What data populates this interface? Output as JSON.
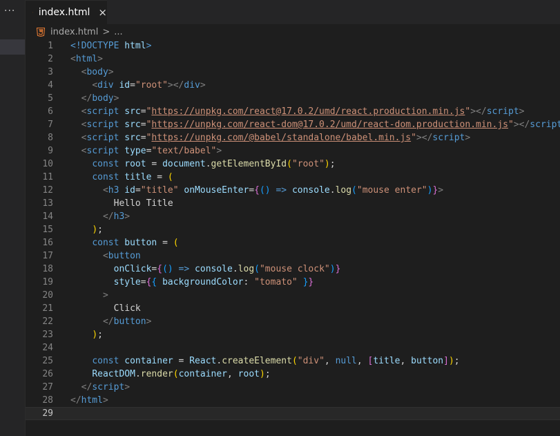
{
  "tab": {
    "file_name": "index.html",
    "close_glyph": "×"
  },
  "breadcrumb": {
    "file_name": "index.html",
    "separator": ">",
    "more": "..."
  },
  "sidebar": {
    "more_glyph": "···"
  },
  "current_line": 29,
  "lines": [
    [
      {
        "c": "tg",
        "t": "<!DOCTYPE "
      },
      {
        "c": "at",
        "t": "html"
      },
      {
        "c": "tg",
        "t": ">"
      }
    ],
    [
      {
        "c": "gy",
        "t": "<"
      },
      {
        "c": "tg",
        "t": "html"
      },
      {
        "c": "gy",
        "t": ">"
      }
    ],
    [
      {
        "c": "tx",
        "t": "  "
      },
      {
        "c": "gy",
        "t": "<"
      },
      {
        "c": "tg",
        "t": "body"
      },
      {
        "c": "gy",
        "t": ">"
      }
    ],
    [
      {
        "c": "tx",
        "t": "    "
      },
      {
        "c": "gy",
        "t": "<"
      },
      {
        "c": "tg",
        "t": "div "
      },
      {
        "c": "at",
        "t": "id"
      },
      {
        "c": "tx",
        "t": "="
      },
      {
        "c": "st",
        "t": "\"root\""
      },
      {
        "c": "gy",
        "t": "></"
      },
      {
        "c": "tg",
        "t": "div"
      },
      {
        "c": "gy",
        "t": ">"
      }
    ],
    [
      {
        "c": "tx",
        "t": "  "
      },
      {
        "c": "gy",
        "t": "</"
      },
      {
        "c": "tg",
        "t": "body"
      },
      {
        "c": "gy",
        "t": ">"
      }
    ],
    [
      {
        "c": "tx",
        "t": "  "
      },
      {
        "c": "gy",
        "t": "<"
      },
      {
        "c": "tg",
        "t": "script "
      },
      {
        "c": "at",
        "t": "src"
      },
      {
        "c": "tx",
        "t": "="
      },
      {
        "c": "st",
        "t": "\""
      },
      {
        "c": "ul",
        "t": "https://unpkg.com/react@17.0.2/umd/react.production.min.js"
      },
      {
        "c": "st",
        "t": "\""
      },
      {
        "c": "gy",
        "t": "></"
      },
      {
        "c": "tg",
        "t": "script"
      },
      {
        "c": "gy",
        "t": ">"
      }
    ],
    [
      {
        "c": "tx",
        "t": "  "
      },
      {
        "c": "gy",
        "t": "<"
      },
      {
        "c": "tg",
        "t": "script "
      },
      {
        "c": "at",
        "t": "src"
      },
      {
        "c": "tx",
        "t": "="
      },
      {
        "c": "st",
        "t": "\""
      },
      {
        "c": "ul",
        "t": "https://unpkg.com/react-dom@17.0.2/umd/react-dom.production.min.js"
      },
      {
        "c": "st",
        "t": "\""
      },
      {
        "c": "gy",
        "t": "></"
      },
      {
        "c": "tg",
        "t": "script"
      },
      {
        "c": "gy",
        "t": ">"
      }
    ],
    [
      {
        "c": "tx",
        "t": "  "
      },
      {
        "c": "gy",
        "t": "<"
      },
      {
        "c": "tg",
        "t": "script "
      },
      {
        "c": "at",
        "t": "src"
      },
      {
        "c": "tx",
        "t": "="
      },
      {
        "c": "st",
        "t": "\""
      },
      {
        "c": "ul",
        "t": "https://unpkg.com/@babel/standalone/babel.min.js"
      },
      {
        "c": "st",
        "t": "\""
      },
      {
        "c": "gy",
        "t": "></"
      },
      {
        "c": "tg",
        "t": "script"
      },
      {
        "c": "gy",
        "t": ">"
      }
    ],
    [
      {
        "c": "tx",
        "t": "  "
      },
      {
        "c": "gy",
        "t": "<"
      },
      {
        "c": "tg",
        "t": "script "
      },
      {
        "c": "at",
        "t": "type"
      },
      {
        "c": "tx",
        "t": "="
      },
      {
        "c": "st",
        "t": "\"text/babel\""
      },
      {
        "c": "gy",
        "t": ">"
      }
    ],
    [
      {
        "c": "tx",
        "t": "    "
      },
      {
        "c": "kw",
        "t": "const "
      },
      {
        "c": "vr",
        "t": "root"
      },
      {
        "c": "tx",
        "t": " = "
      },
      {
        "c": "vr",
        "t": "document"
      },
      {
        "c": "tx",
        "t": "."
      },
      {
        "c": "fn",
        "t": "getElementById"
      },
      {
        "c": "yb",
        "t": "("
      },
      {
        "c": "st",
        "t": "\"root\""
      },
      {
        "c": "yb",
        "t": ")"
      },
      {
        "c": "tx",
        "t": ";"
      }
    ],
    [
      {
        "c": "tx",
        "t": "    "
      },
      {
        "c": "kw",
        "t": "const "
      },
      {
        "c": "vr",
        "t": "title"
      },
      {
        "c": "tx",
        "t": " = "
      },
      {
        "c": "yb",
        "t": "("
      }
    ],
    [
      {
        "c": "tx",
        "t": "      "
      },
      {
        "c": "gy",
        "t": "<"
      },
      {
        "c": "tg",
        "t": "h3 "
      },
      {
        "c": "at",
        "t": "id"
      },
      {
        "c": "tx",
        "t": "="
      },
      {
        "c": "st",
        "t": "\"title\" "
      },
      {
        "c": "at",
        "t": "onMouseEnter"
      },
      {
        "c": "tx",
        "t": "="
      },
      {
        "c": "pb",
        "t": "{"
      },
      {
        "c": "bb",
        "t": "()"
      },
      {
        "c": "kw",
        "t": " => "
      },
      {
        "c": "vr",
        "t": "console"
      },
      {
        "c": "tx",
        "t": "."
      },
      {
        "c": "fn",
        "t": "log"
      },
      {
        "c": "bb",
        "t": "("
      },
      {
        "c": "st",
        "t": "\"mouse enter\""
      },
      {
        "c": "bb",
        "t": ")"
      },
      {
        "c": "pb",
        "t": "}"
      },
      {
        "c": "gy",
        "t": ">"
      }
    ],
    [
      {
        "c": "tx",
        "t": "        Hello Title"
      }
    ],
    [
      {
        "c": "tx",
        "t": "      "
      },
      {
        "c": "gy",
        "t": "</"
      },
      {
        "c": "tg",
        "t": "h3"
      },
      {
        "c": "gy",
        "t": ">"
      }
    ],
    [
      {
        "c": "tx",
        "t": "    "
      },
      {
        "c": "yb",
        "t": ")"
      },
      {
        "c": "tx",
        "t": ";"
      }
    ],
    [
      {
        "c": "tx",
        "t": "    "
      },
      {
        "c": "kw",
        "t": "const "
      },
      {
        "c": "vr",
        "t": "button"
      },
      {
        "c": "tx",
        "t": " = "
      },
      {
        "c": "yb",
        "t": "("
      }
    ],
    [
      {
        "c": "tx",
        "t": "      "
      },
      {
        "c": "gy",
        "t": "<"
      },
      {
        "c": "tg",
        "t": "button"
      }
    ],
    [
      {
        "c": "tx",
        "t": "        "
      },
      {
        "c": "at",
        "t": "onClick"
      },
      {
        "c": "tx",
        "t": "="
      },
      {
        "c": "pb",
        "t": "{"
      },
      {
        "c": "bb",
        "t": "()"
      },
      {
        "c": "kw",
        "t": " => "
      },
      {
        "c": "vr",
        "t": "console"
      },
      {
        "c": "tx",
        "t": "."
      },
      {
        "c": "fn",
        "t": "log"
      },
      {
        "c": "bb",
        "t": "("
      },
      {
        "c": "st",
        "t": "\"mouse clock\""
      },
      {
        "c": "bb",
        "t": ")"
      },
      {
        "c": "pb",
        "t": "}"
      }
    ],
    [
      {
        "c": "tx",
        "t": "        "
      },
      {
        "c": "at",
        "t": "style"
      },
      {
        "c": "tx",
        "t": "="
      },
      {
        "c": "pb",
        "t": "{"
      },
      {
        "c": "bb",
        "t": "{"
      },
      {
        "c": "vr",
        "t": " backgroundColor"
      },
      {
        "c": "tx",
        "t": ": "
      },
      {
        "c": "st",
        "t": "\"tomato\""
      },
      {
        "c": "bb",
        "t": " }"
      },
      {
        "c": "pb",
        "t": "}"
      }
    ],
    [
      {
        "c": "tx",
        "t": "      "
      },
      {
        "c": "gy",
        "t": ">"
      }
    ],
    [
      {
        "c": "tx",
        "t": "        Click"
      }
    ],
    [
      {
        "c": "tx",
        "t": "      "
      },
      {
        "c": "gy",
        "t": "</"
      },
      {
        "c": "tg",
        "t": "button"
      },
      {
        "c": "gy",
        "t": ">"
      }
    ],
    [
      {
        "c": "tx",
        "t": "    "
      },
      {
        "c": "yb",
        "t": ")"
      },
      {
        "c": "tx",
        "t": ";"
      }
    ],
    [],
    [
      {
        "c": "tx",
        "t": "    "
      },
      {
        "c": "kw",
        "t": "const "
      },
      {
        "c": "vr",
        "t": "container"
      },
      {
        "c": "tx",
        "t": " = "
      },
      {
        "c": "vr",
        "t": "React"
      },
      {
        "c": "tx",
        "t": "."
      },
      {
        "c": "fn",
        "t": "createElement"
      },
      {
        "c": "yb",
        "t": "("
      },
      {
        "c": "st",
        "t": "\"div\""
      },
      {
        "c": "tx",
        "t": ", "
      },
      {
        "c": "kw",
        "t": "null"
      },
      {
        "c": "tx",
        "t": ", "
      },
      {
        "c": "pb",
        "t": "["
      },
      {
        "c": "vr",
        "t": "title"
      },
      {
        "c": "tx",
        "t": ", "
      },
      {
        "c": "vr",
        "t": "button"
      },
      {
        "c": "pb",
        "t": "]"
      },
      {
        "c": "yb",
        "t": ")"
      },
      {
        "c": "tx",
        "t": ";"
      }
    ],
    [
      {
        "c": "tx",
        "t": "    "
      },
      {
        "c": "vr",
        "t": "ReactDOM"
      },
      {
        "c": "tx",
        "t": "."
      },
      {
        "c": "fn",
        "t": "render"
      },
      {
        "c": "yb",
        "t": "("
      },
      {
        "c": "vr",
        "t": "container"
      },
      {
        "c": "tx",
        "t": ", "
      },
      {
        "c": "vr",
        "t": "root"
      },
      {
        "c": "yb",
        "t": ")"
      },
      {
        "c": "tx",
        "t": ";"
      }
    ],
    [
      {
        "c": "tx",
        "t": "  "
      },
      {
        "c": "gy",
        "t": "</"
      },
      {
        "c": "tg",
        "t": "script"
      },
      {
        "c": "gy",
        "t": ">"
      }
    ],
    [
      {
        "c": "gy",
        "t": "</"
      },
      {
        "c": "tg",
        "t": "html"
      },
      {
        "c": "gy",
        "t": ">"
      }
    ],
    []
  ]
}
